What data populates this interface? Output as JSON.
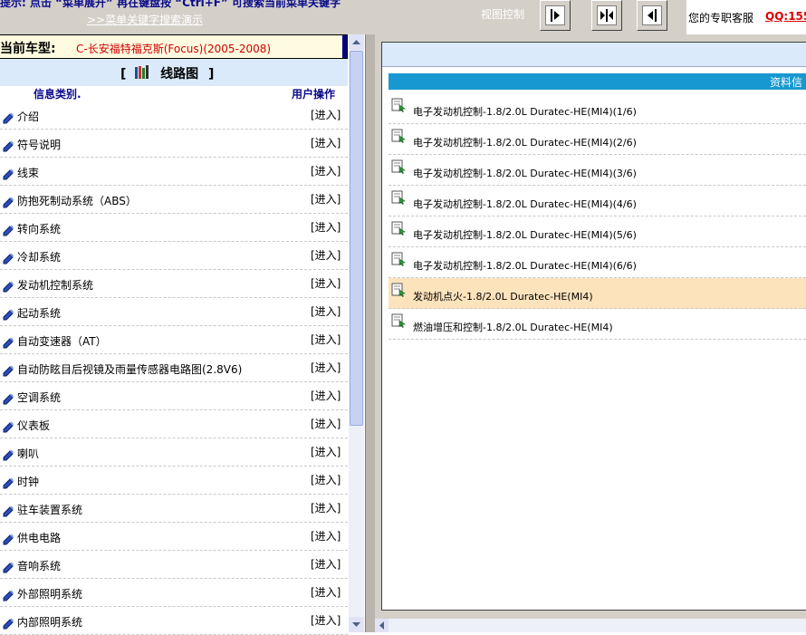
{
  "topbar": {
    "hint": "提示: 点击 “菜单展开” 再在键盘按 “Ctrl+F” 可搜索当前菜单关键字",
    "hint_link": ">>菜单关键字搜索演示",
    "view_label": "视图控制",
    "buttons": [
      {
        "name": "expand-right",
        "icon": "arrow-right-icon"
      },
      {
        "name": "split-view",
        "icon": "split-icon"
      },
      {
        "name": "expand-left",
        "icon": "arrow-left-icon"
      }
    ],
    "service_label": "您的专职客服",
    "qq": "QQ:155"
  },
  "left": {
    "car_label": "当前车型:",
    "car_value": "C-长安福特福克斯(Focus)(2005-2008)",
    "section_bracket_open": "[",
    "section_title": "线路图",
    "section_bracket_close": "]",
    "col_category": "信息类别.",
    "col_action": "用户操作",
    "items": [
      {
        "name": "介绍",
        "action": "[进入]"
      },
      {
        "name": "符号说明",
        "action": "[进入]"
      },
      {
        "name": "线束",
        "action": "[进入]"
      },
      {
        "name": "防抱死制动系统（ABS）",
        "action": "[进入]"
      },
      {
        "name": "转向系统",
        "action": "[进入]"
      },
      {
        "name": "冷却系统",
        "action": "[进入]"
      },
      {
        "name": "发动机控制系统",
        "action": "[进入]"
      },
      {
        "name": "起动系统",
        "action": "[进入]"
      },
      {
        "name": "自动变速器（AT）",
        "action": "[进入]"
      },
      {
        "name": "自动防眩目后视镜及雨量传感器电路图(2.8V6)",
        "action": "[进入]"
      },
      {
        "name": "空调系统",
        "action": "[进入]"
      },
      {
        "name": "仪表板",
        "action": "[进入]"
      },
      {
        "name": "喇叭",
        "action": "[进入]"
      },
      {
        "name": "时钟",
        "action": "[进入]"
      },
      {
        "name": "驻车装置系统",
        "action": "[进入]"
      },
      {
        "name": "供电电路",
        "action": "[进入]"
      },
      {
        "name": "音响系统",
        "action": "[进入]"
      },
      {
        "name": "外部照明系统",
        "action": "[进入]"
      },
      {
        "name": "内部照明系统",
        "action": "[进入]"
      }
    ]
  },
  "right": {
    "header": "资料信",
    "items": [
      {
        "name": "电子发动机控制-1.8/2.0L  Duratec-HE(MI4)(1/6)",
        "highlight": false
      },
      {
        "name": "电子发动机控制-1.8/2.0L  Duratec-HE(MI4)(2/6)",
        "highlight": false
      },
      {
        "name": "电子发动机控制-1.8/2.0L  Duratec-HE(MI4)(3/6)",
        "highlight": false
      },
      {
        "name": "电子发动机控制-1.8/2.0L  Duratec-HE(MI4)(4/6)",
        "highlight": false
      },
      {
        "name": "电子发动机控制-1.8/2.0L  Duratec-HE(MI4)(5/6)",
        "highlight": false
      },
      {
        "name": "电子发动机控制-1.8/2.0L  Duratec-HE(MI4)(6/6)",
        "highlight": false
      },
      {
        "name": "发动机点火-1.8/2.0L  Duratec-HE(MI4)",
        "highlight": true
      },
      {
        "name": "燃油增压和控制-1.8/2.0L  Duratec-HE(MI4)",
        "highlight": false
      }
    ]
  },
  "colors": {
    "accent_blue": "#1798d0",
    "highlight": "#fde3bc",
    "car_text": "#cc0000",
    "header_text": "#0a0a8a"
  }
}
